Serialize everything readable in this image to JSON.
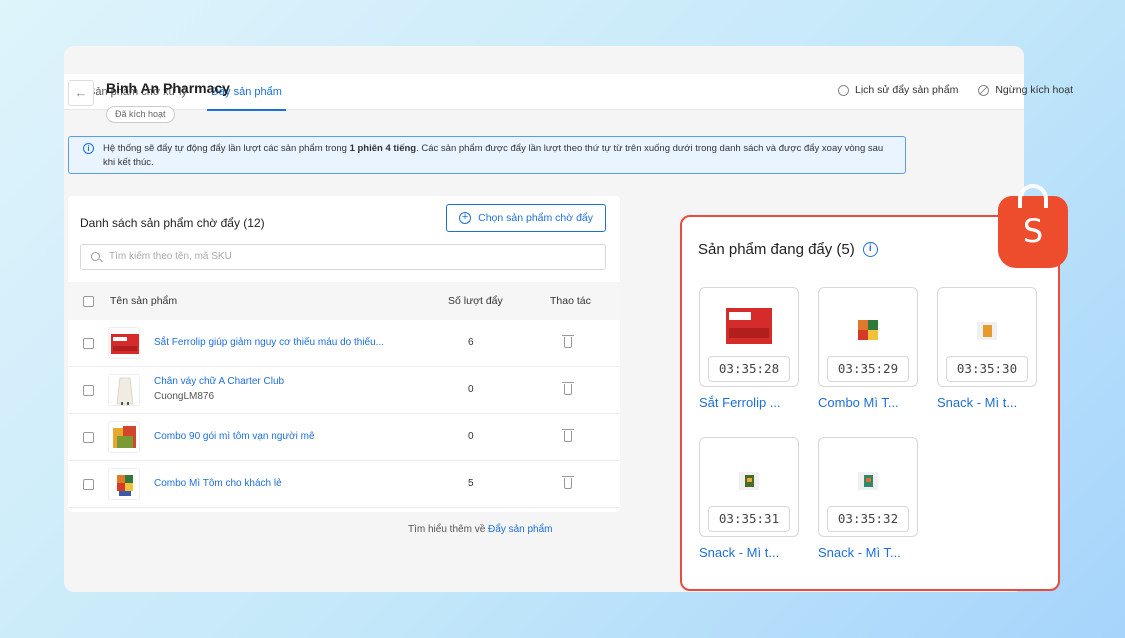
{
  "tabs": [
    {
      "label": "Sản phẩm chờ xử lý"
    },
    {
      "label": "Đẩy sản phẩm"
    }
  ],
  "shop": {
    "name": "Binh An Pharmacy",
    "status": "Đã kích hoạt"
  },
  "header_actions": {
    "history": "Lịch sử đẩy sản phẩm",
    "deactivate": "Ngừng kích hoạt"
  },
  "banner": {
    "text_before": "Hệ thống sẽ đẩy tự động đẩy lần lượt các sản phẩm trong ",
    "bold": "1 phiên 4 tiếng",
    "text_after": ". Các sản phẩm được đẩy lần lượt theo thứ tự từ trên xuống dưới trong danh sách và được đẩy xoay vòng sau khi kết thúc."
  },
  "list": {
    "title": "Danh sách sản phẩm chờ đẩy (12)",
    "choose_button": "Chọn sản phẩm chờ đẩy",
    "search_placeholder": "Tìm kiếm theo tên, mã SKU",
    "columns": {
      "name": "Tên sản phẩm",
      "count": "Số lượt đẩy",
      "action": "Thao tác"
    },
    "rows": [
      {
        "name": "Sắt Ferrolip giúp giảm nguy cơ thiếu máu do thiếu...",
        "sku": "",
        "count": "6"
      },
      {
        "name": "Chân váy chữ A Charter Club",
        "sku": "CuongLM876",
        "count": "0"
      },
      {
        "name": "Combo 90 gói mì tôm vạn người mê",
        "sku": "",
        "count": "0"
      },
      {
        "name": "Combo Mì Tôm cho khách lẻ",
        "sku": "",
        "count": "5"
      }
    ]
  },
  "footer": {
    "text": "Tìm hiểu thêm về ",
    "link": "Đẩy sản phẩm"
  },
  "pushing": {
    "title": "Sản phẩm đang đẩy (5)",
    "items": [
      {
        "timer": "03:35:28",
        "name": "Sắt Ferrolip ..."
      },
      {
        "timer": "03:35:29",
        "name": "Combo Mì T..."
      },
      {
        "timer": "03:35:30",
        "name": "Snack - Mì t..."
      },
      {
        "timer": "03:35:31",
        "name": "Snack - Mì t..."
      },
      {
        "timer": "03:35:32",
        "name": "Snack - Mì T..."
      }
    ]
  },
  "logo": {
    "letter": "S"
  },
  "colors": {
    "accent": "#1d6fd8",
    "brand": "#ee4d2d",
    "overlay_border": "#e94b3c"
  }
}
